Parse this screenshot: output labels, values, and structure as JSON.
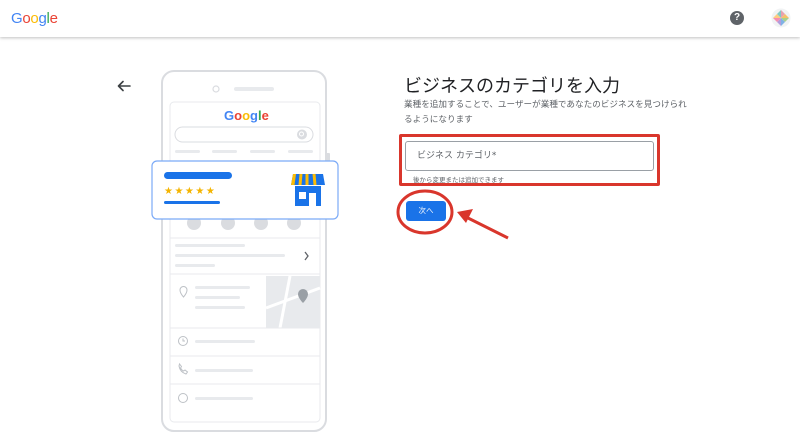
{
  "header": {
    "logo_letters": [
      {
        "ch": "G",
        "color": "#4285F4"
      },
      {
        "ch": "o",
        "color": "#EA4335"
      },
      {
        "ch": "o",
        "color": "#FBBC05"
      },
      {
        "ch": "g",
        "color": "#4285F4"
      },
      {
        "ch": "l",
        "color": "#34A853"
      },
      {
        "ch": "e",
        "color": "#EA4335"
      }
    ],
    "help_icon": "question-circle-icon",
    "help_glyph": "?",
    "avatar_icon": "account-avatar-icon"
  },
  "illustration": {
    "google_logo_letters": [
      {
        "ch": "G",
        "color": "#4285F4"
      },
      {
        "ch": "o",
        "color": "#EA4335"
      },
      {
        "ch": "o",
        "color": "#FBBC05"
      },
      {
        "ch": "g",
        "color": "#4285F4"
      },
      {
        "ch": "l",
        "color": "#34A853"
      },
      {
        "ch": "e",
        "color": "#EA4335"
      }
    ],
    "stars": "★★★★★",
    "star_color": "#F4B400"
  },
  "form": {
    "title": "ビジネスのカテゴリを入力",
    "description": "業種を追加することで、ユーザーが業種であなたのビジネスを見つけられるようになります",
    "category_placeholder": "ビジネス カテゴリ*",
    "category_value": "",
    "hint": "後から変更または追加できます",
    "next_label": "次へ"
  },
  "colors": {
    "accent": "#1a73e8",
    "annotation_red": "#d9362c"
  }
}
